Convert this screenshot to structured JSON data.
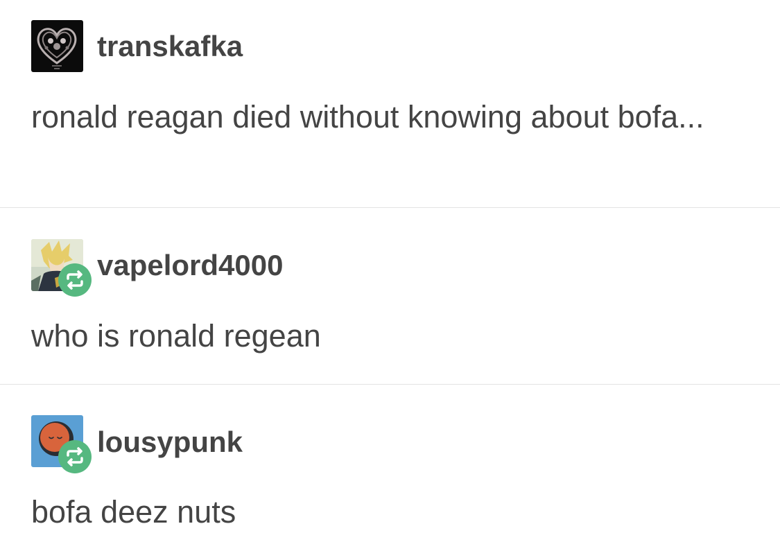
{
  "posts": [
    {
      "username": "transkafka",
      "text": "ronald reagan died without knowing about bofa...",
      "reblog": false,
      "avatar_icon": "heart-art-avatar"
    },
    {
      "username": "vapelord4000",
      "text": "who is ronald regean",
      "reblog": true,
      "avatar_icon": "anime-character-avatar"
    },
    {
      "username": "lousypunk",
      "text": "bofa deez nuts",
      "reblog": true,
      "avatar_icon": "sleepy-face-avatar"
    }
  ],
  "colors": {
    "text": "#444444",
    "reblog_badge": "#56b880",
    "divider": "#e3e3e3",
    "avatar3_bg": "#5a9fd4",
    "avatar3_face": "#d8643c"
  }
}
